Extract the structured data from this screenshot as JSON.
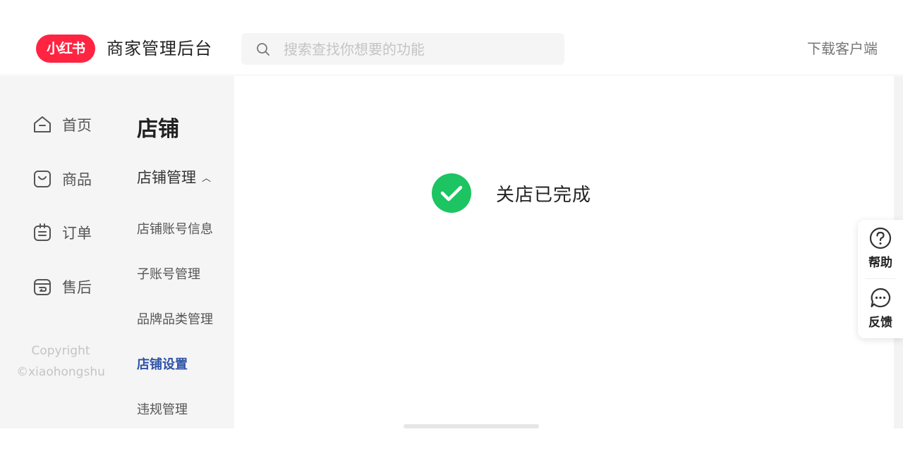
{
  "header": {
    "logo_text": "小红书",
    "brand_title": "商家管理后台",
    "search_placeholder": "搜索查找你想要的功能",
    "download_label": "下载客户端"
  },
  "primary_nav": {
    "items": [
      {
        "label": "首页",
        "icon": "home-icon"
      },
      {
        "label": "商品",
        "icon": "bag-icon"
      },
      {
        "label": "订单",
        "icon": "order-icon"
      },
      {
        "label": "售后",
        "icon": "after-sale-icon"
      }
    ],
    "copyright_line1": "Copyright",
    "copyright_line2": "©xiaohongshu"
  },
  "secondary_nav": {
    "title": "店铺",
    "group_label": "店铺管理",
    "items": [
      {
        "label": "店铺账号信息",
        "active": false
      },
      {
        "label": "子账号管理",
        "active": false
      },
      {
        "label": "品牌品类管理",
        "active": false
      },
      {
        "label": "店铺设置",
        "active": true
      },
      {
        "label": "违规管理",
        "active": false
      }
    ]
  },
  "main": {
    "result_text": "关店已完成"
  },
  "float_panel": {
    "help_label": "帮助",
    "feedback_label": "反馈"
  },
  "colors": {
    "brand_red": "#ff2442",
    "success_green": "#1dc462",
    "active_blue": "#2f54a8"
  }
}
